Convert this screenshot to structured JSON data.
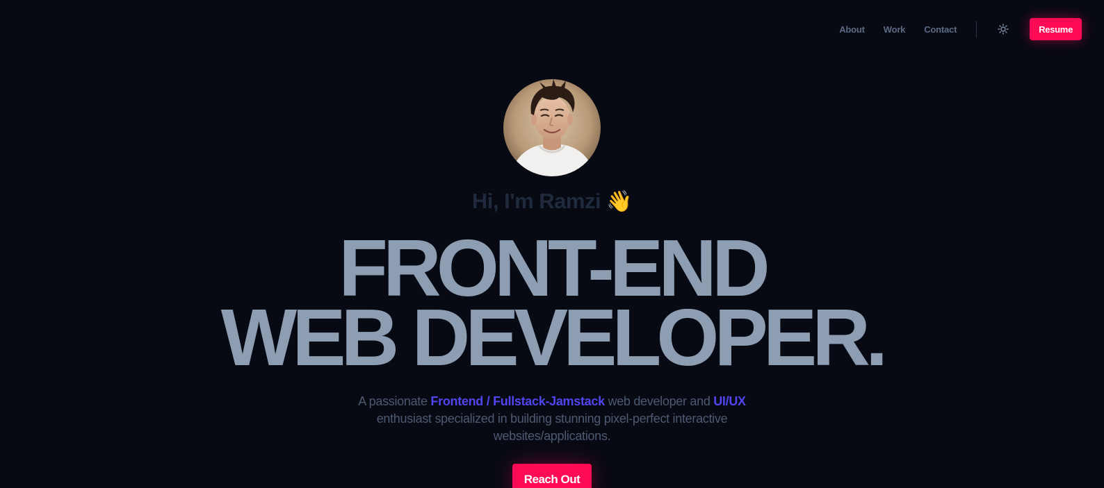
{
  "nav": {
    "links": [
      {
        "label": "About"
      },
      {
        "label": "Work"
      },
      {
        "label": "Contact"
      }
    ],
    "theme_icon": "sun-icon",
    "resume_label": "Resume"
  },
  "hero": {
    "avatar_icon": "profile-photo",
    "greeting": "Hi, I'm Ramzi",
    "wave_emoji": "👋",
    "headline_line1": "FRONT-END",
    "headline_line2": "WEB DEVELOPER.",
    "intro": {
      "part1": "A passionate ",
      "highlight1": "Frontend / Fullstack-Jamstack",
      "part2": " web developer and ",
      "highlight2": "UI/UX",
      "part3": " enthusiast specialized in building stunning pixel-perfect interactive websites/applications."
    },
    "cta_label": "Reach Out"
  },
  "colors": {
    "background": "#070a13",
    "accent": "#ff0a55",
    "highlight": "#5145f0",
    "headline": "#8d9db2",
    "muted_text": "#4d5a72"
  }
}
